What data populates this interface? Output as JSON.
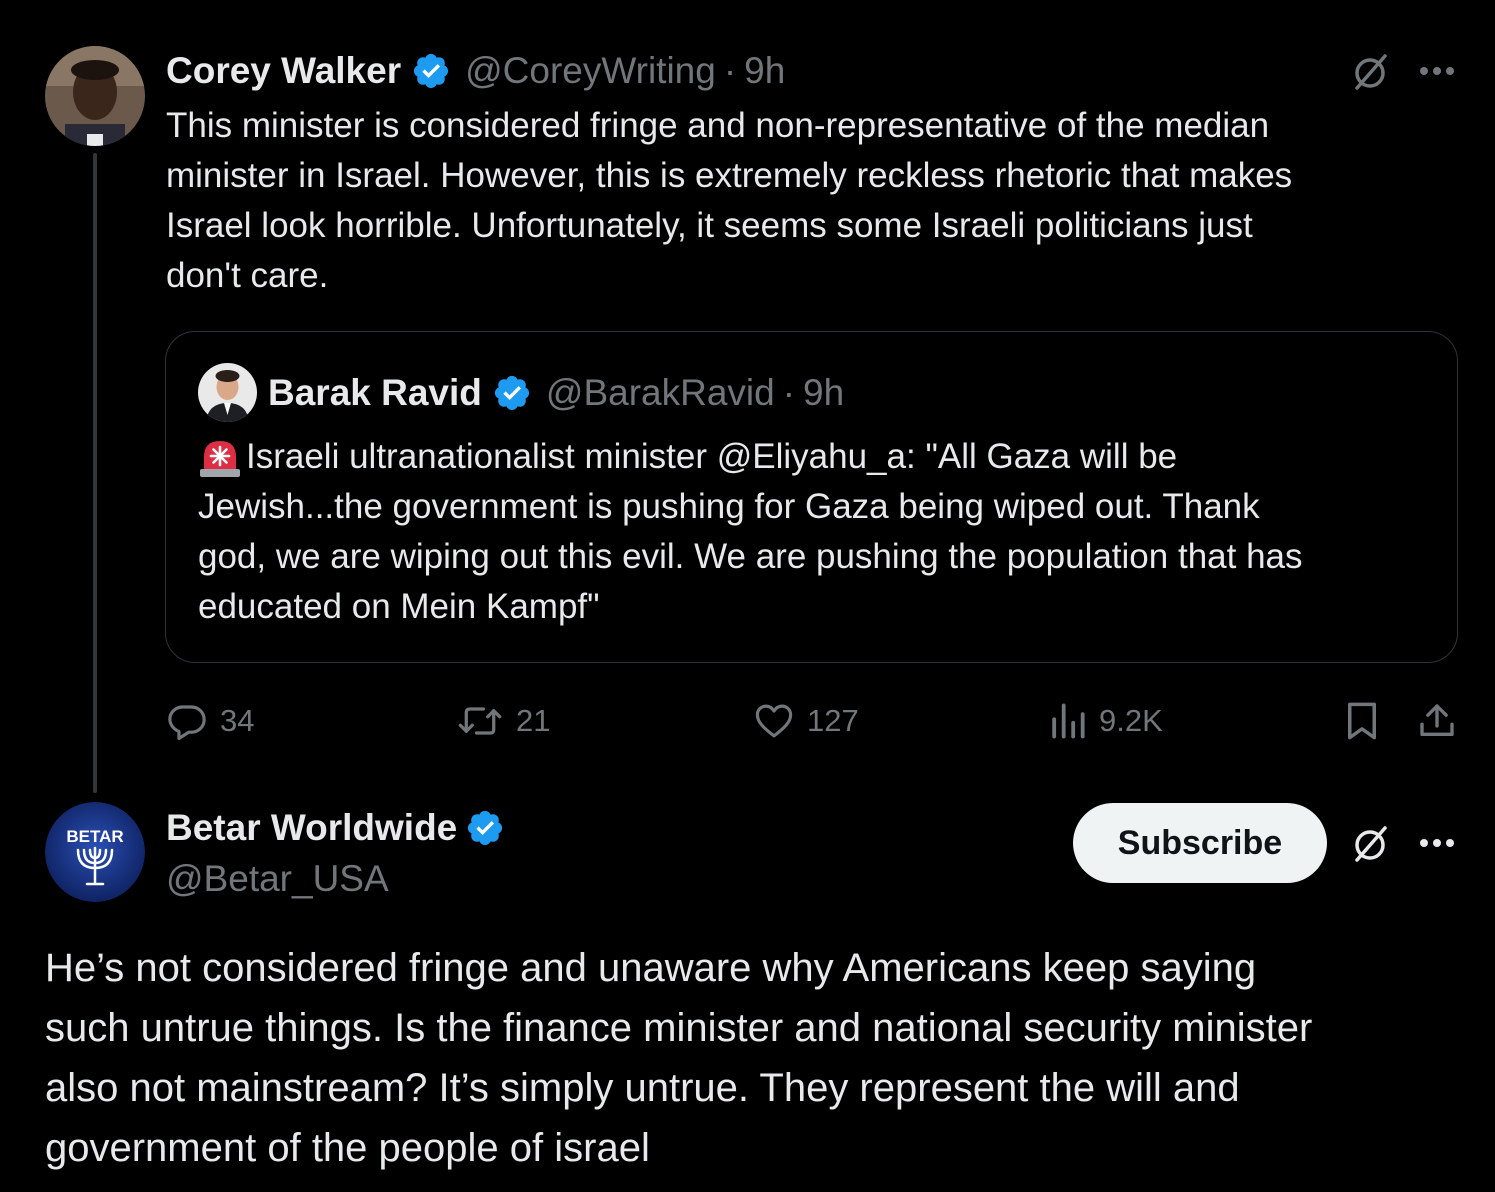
{
  "post1": {
    "author_name": "Corey Walker",
    "handle": "@CoreyWriting",
    "separator": "·",
    "time": "9h",
    "text_lines": [
      "This minister is considered fringe and non-representative of the median",
      "minister in Israel. However, this is extremely reckless rhetoric that makes",
      "Israel look horrible. Unfortunately, it seems some Israeli politicians just",
      "don't care."
    ],
    "avatar_icon": "person-photo-avatar",
    "grok_icon": "slashed-circle-icon",
    "more_icon": "more-dots-icon"
  },
  "quote": {
    "author_name": "Barak Ravid",
    "handle": "@BarakRavid",
    "separator": "·",
    "time": "9h",
    "emoji_icon": "rotating-light-emoji",
    "text_lines": [
      "Israeli ultranationalist minister @Eliyahu_a: \"All Gaza will be",
      "Jewish...the government is pushing for Gaza being wiped out. Thank",
      "god, we are wiping out this evil. We are pushing the population that has",
      "educated on Mein Kampf\""
    ]
  },
  "actions": {
    "replies": "34",
    "reposts": "21",
    "likes": "127",
    "views": "9.2K"
  },
  "post2": {
    "author_name": "Betar Worldwide",
    "handle": "@Betar_USA",
    "subscribe_label": "Subscribe",
    "avatar_text": "BETAR",
    "text_lines": [
      "He’s not considered fringe and unaware why Americans keep saying",
      "such untrue things. Is the finance minister and national security minister",
      "also not mainstream? It’s simply untrue. They represent the will and",
      "government of the people of israel"
    ]
  },
  "colors": {
    "background": "#000000",
    "text": "#e7e9ea",
    "secondary": "#71767b",
    "verified": "#1d9bf0",
    "border": "#2f3336"
  }
}
